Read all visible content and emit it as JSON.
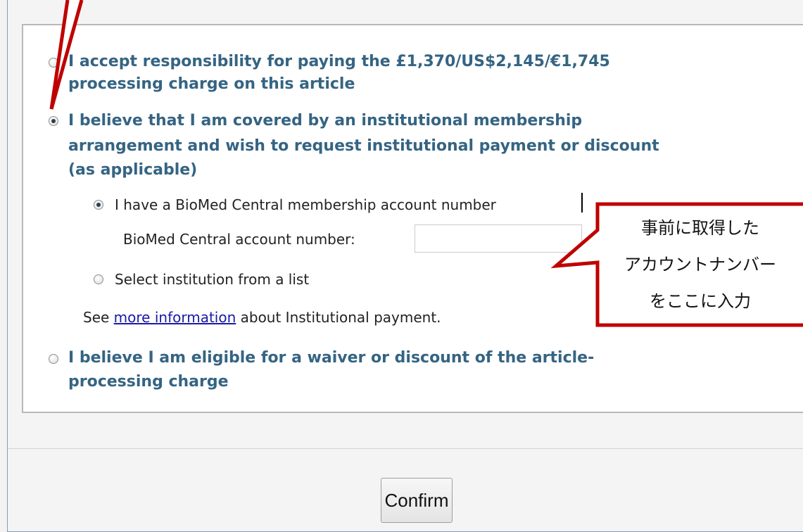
{
  "options": {
    "accept": "I accept responsibility for paying the £1,370/US$2,145/€1,745 processing charge on this article",
    "accept_line1": "I accept responsibility for paying the £1,370/US$2,145/€1,745",
    "accept_line2": "processing charge on this article",
    "institutional_line1": "I believe that I am covered by an institutional membership",
    "institutional_line2": "arrangement and wish to request institutional payment or discount",
    "institutional_line3": "(as applicable)",
    "waiver_line1": "I believe I am eligible for a waiver or discount of the article-",
    "waiver_line2": "processing charge"
  },
  "sub_options": {
    "have_account": "I have a BioMed Central membership account number",
    "account_label": "BioMed Central account number:",
    "account_value": "",
    "select_institution": "Select institution from a list"
  },
  "info": {
    "prefix": "See ",
    "link": "more information",
    "suffix": " about Institutional payment."
  },
  "buttons": {
    "confirm": "Confirm"
  },
  "callout": {
    "line1": "事前に取得した",
    "line2": "アカウントナンバー",
    "line3": "をここに入力"
  },
  "colors": {
    "option_text": "#356483",
    "annotation_red": "#c00000",
    "link": "#1a1aa6"
  }
}
